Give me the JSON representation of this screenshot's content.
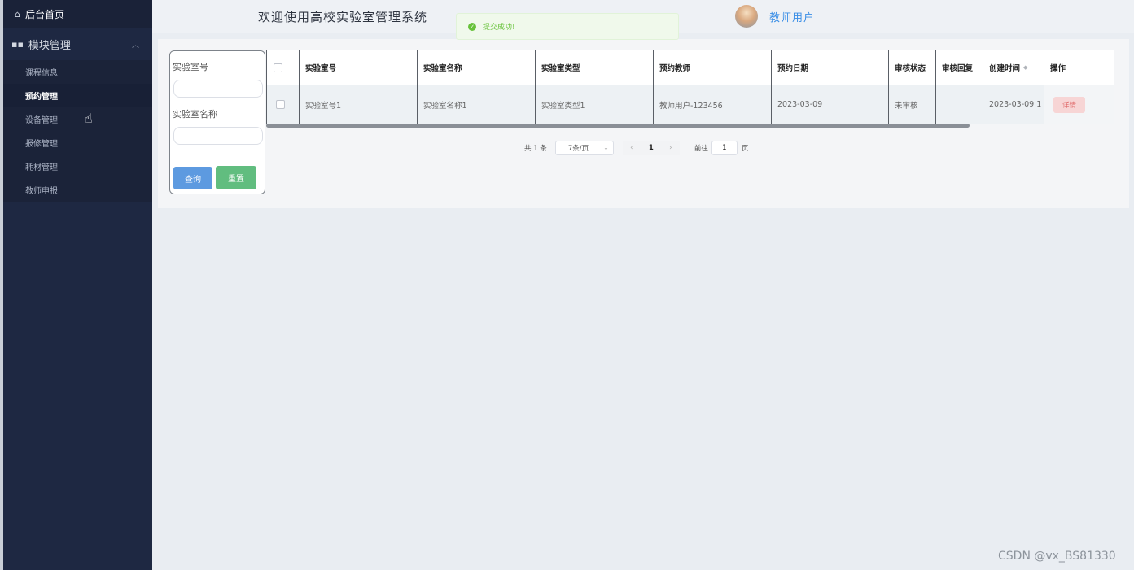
{
  "sidebar": {
    "home_label": "后台首页",
    "module_label": "模块管理",
    "items": [
      {
        "label": "课程信息"
      },
      {
        "label": "预约管理"
      },
      {
        "label": "设备管理"
      },
      {
        "label": "报修管理"
      },
      {
        "label": "耗材管理"
      },
      {
        "label": "教师申报"
      }
    ],
    "active_item": "预约管理"
  },
  "header": {
    "title": "欢迎使用高校实验室管理系统",
    "user_name": "教师用户"
  },
  "toast": {
    "message": "提交成功!"
  },
  "search": {
    "lab_no_label": "实验室号",
    "lab_no_value": "",
    "lab_name_label": "实验室名称",
    "lab_name_value": "",
    "query_label": "查询",
    "reset_label": "重置"
  },
  "table": {
    "headers": {
      "lab_no": "实验室号",
      "lab_name": "实验室名称",
      "lab_type": "实验室类型",
      "teacher": "预约教师",
      "date": "预约日期",
      "status": "审核状态",
      "reply": "审核回复",
      "created": "创建时间",
      "action": "操作"
    },
    "rows": [
      {
        "lab_no": "实验室号1",
        "lab_name": "实验室名称1",
        "lab_type": "实验室类型1",
        "teacher": "教师用户-123456",
        "date": "2023-03-09",
        "status": "未审核",
        "reply": "",
        "created": "2023-03-09 1",
        "action": "详情"
      }
    ]
  },
  "pagination": {
    "total": "共 1 条",
    "page_size": "7条/页",
    "current_page": "1",
    "goto_label": "前往",
    "goto_value": "1",
    "page_unit": "页"
  },
  "watermark": "CSDN @vx_BS81330",
  "colors": {
    "sidebar_bg": "#1e2842",
    "accent_blue": "#3a8ee6",
    "success_green": "#67c23a",
    "query_button": "#5d9ae0",
    "reset_button": "#61bd7f",
    "detail_button": "#f7d5d5"
  }
}
